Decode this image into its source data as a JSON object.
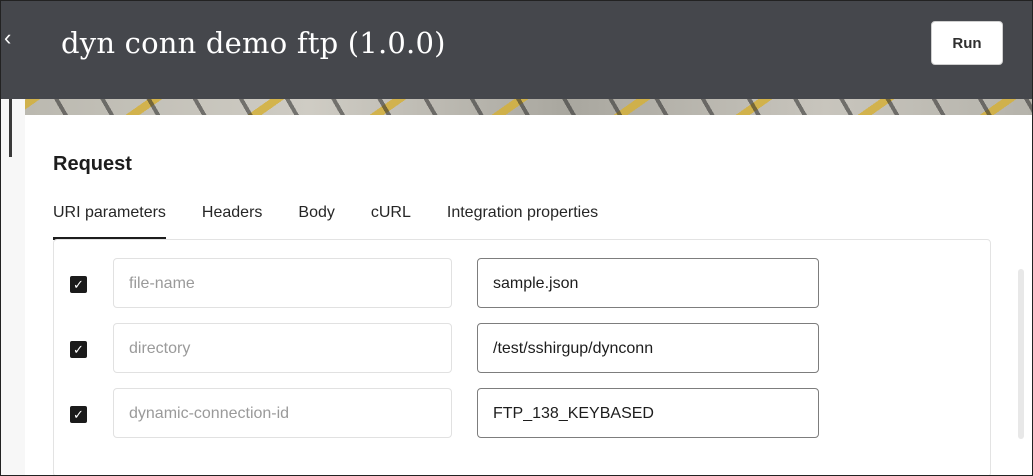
{
  "header": {
    "title": "dyn conn demo ftp (1.0.0)",
    "run_label": "Run",
    "back_icon": "chevron-left-icon",
    "bg_color": "#45474c"
  },
  "request": {
    "section_title": "Request",
    "tabs": [
      {
        "label": "URI parameters",
        "active": true
      },
      {
        "label": "Headers",
        "active": false
      },
      {
        "label": "Body",
        "active": false
      },
      {
        "label": "cURL",
        "active": false
      },
      {
        "label": "Integration properties",
        "active": false
      }
    ],
    "params": [
      {
        "checked": true,
        "name": "file-name",
        "value": "sample.json"
      },
      {
        "checked": true,
        "name": "directory",
        "value": "/test/sshirgup/dynconn"
      },
      {
        "checked": true,
        "name": "dynamic-connection-id",
        "value": "FTP_138_KEYBASED"
      }
    ]
  }
}
